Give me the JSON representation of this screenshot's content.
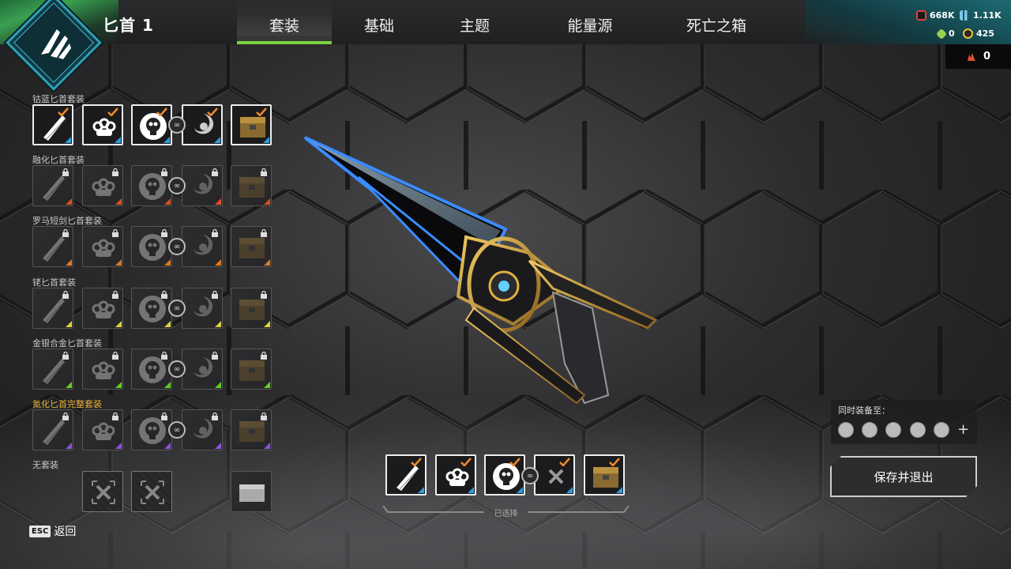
{
  "header": {
    "title": "匕首 1",
    "tabs": [
      {
        "label": "套装",
        "active": true
      },
      {
        "label": "基础",
        "active": false
      },
      {
        "label": "主题",
        "active": false
      },
      {
        "label": "能量源",
        "active": false
      },
      {
        "label": "死亡之箱",
        "active": false
      }
    ]
  },
  "currency": {
    "legend_tokens": "668K",
    "apex_coins": "1.11K",
    "crafting_gems": "0",
    "heirloom_shards": "425",
    "crafting_metals": "0"
  },
  "sets": [
    {
      "name": "钴蓝匕首套装",
      "owned": true,
      "tiles": [
        "owned",
        "owned",
        "owned",
        "owned",
        "owned"
      ],
      "corner": "#2aa0e0"
    },
    {
      "name": "融化匕首套装",
      "owned": false,
      "corner": "#e05020"
    },
    {
      "name": "罗马短剑匕首套装",
      "owned": false,
      "corner": "#e07a20"
    },
    {
      "name": "铑匕首套装",
      "owned": false,
      "corner": "#e0d040"
    },
    {
      "name": "金银合金匕首套装",
      "owned": false,
      "corner": "#60d020"
    },
    {
      "name": "氮化匕首完整套装",
      "owned": false,
      "highlight": true,
      "corner": "#9050e0"
    },
    {
      "name": "无套装",
      "owned": false,
      "corner": "#888888"
    }
  ],
  "selected_label": "已选择",
  "equip": {
    "label": "同时装备至：",
    "plus": "+"
  },
  "save_button": "保存并退出",
  "esc": {
    "key": "ESC",
    "label": "返回"
  },
  "colors": {
    "accent_green": "#7bd23f",
    "gold_label": "#e8b23a",
    "teal": "#2fa0b4"
  }
}
